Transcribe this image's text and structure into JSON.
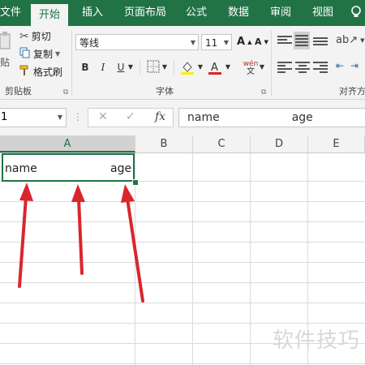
{
  "tabs": [
    "文件",
    "开始",
    "插入",
    "页面布局",
    "公式",
    "数据",
    "审阅",
    "视图"
  ],
  "active_tab": "开始",
  "clipboard": {
    "paste_label": "贴",
    "cut_label": "剪切",
    "copy_label": "复制",
    "format_painter_label": "格式刷",
    "group_label": "剪贴板"
  },
  "font": {
    "font_name": "等线",
    "font_size": "11",
    "bold": "B",
    "italic": "I",
    "underline": "U",
    "phonetic": "wén",
    "group_label": "字体",
    "font_color": "#e02020",
    "highlight_color": "#ffee00"
  },
  "alignment": {
    "group_label": "对齐方"
  },
  "formula_bar": {
    "name_box": "1",
    "formula_text": "name                    age"
  },
  "sheet": {
    "columns": [
      "A",
      "B",
      "C",
      "D",
      "E"
    ],
    "selected_column": "A",
    "cell_a1_left": "name",
    "cell_a1_right": "age"
  },
  "arrow_color": "#d9262c",
  "watermark": "软件技巧",
  "theme": {
    "accent": "#217346"
  }
}
